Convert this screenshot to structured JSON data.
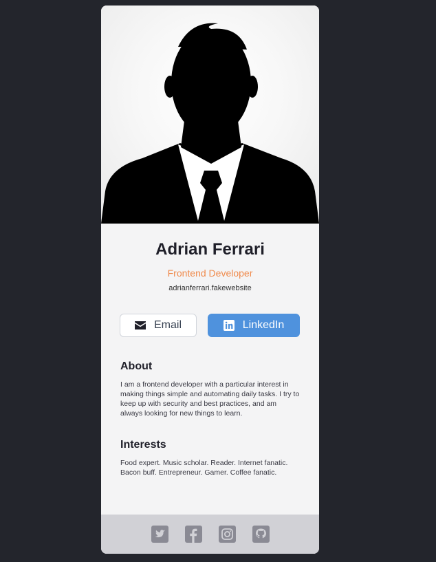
{
  "profile": {
    "name": "Adrian Ferrari",
    "role": "Frontend Developer",
    "website": "adrianferrari.fakewebsite"
  },
  "buttons": {
    "email_label": "Email",
    "linkedin_label": "LinkedIn"
  },
  "about": {
    "heading": "About",
    "text": "I am a frontend developer with a particular interest in making things simple and automating daily tasks. I try to keep up with security and best practices, and am always looking for new things to learn."
  },
  "interests": {
    "heading": "Interests",
    "text": "Food expert. Music scholar. Reader. Internet fanatic. Bacon buff. Entrepreneur. Gamer. Coffee fanatic."
  },
  "footer": {
    "icons": [
      "twitter-icon",
      "facebook-icon",
      "instagram-icon",
      "github-icon"
    ]
  },
  "colors": {
    "page_background": "#23252c",
    "card_background": "#f4f4f5",
    "accent_orange": "#f08a4b",
    "linkedin_blue": "#4f92dd",
    "footer_background": "#d1d1d6",
    "footer_icon": "#8a8a94"
  }
}
